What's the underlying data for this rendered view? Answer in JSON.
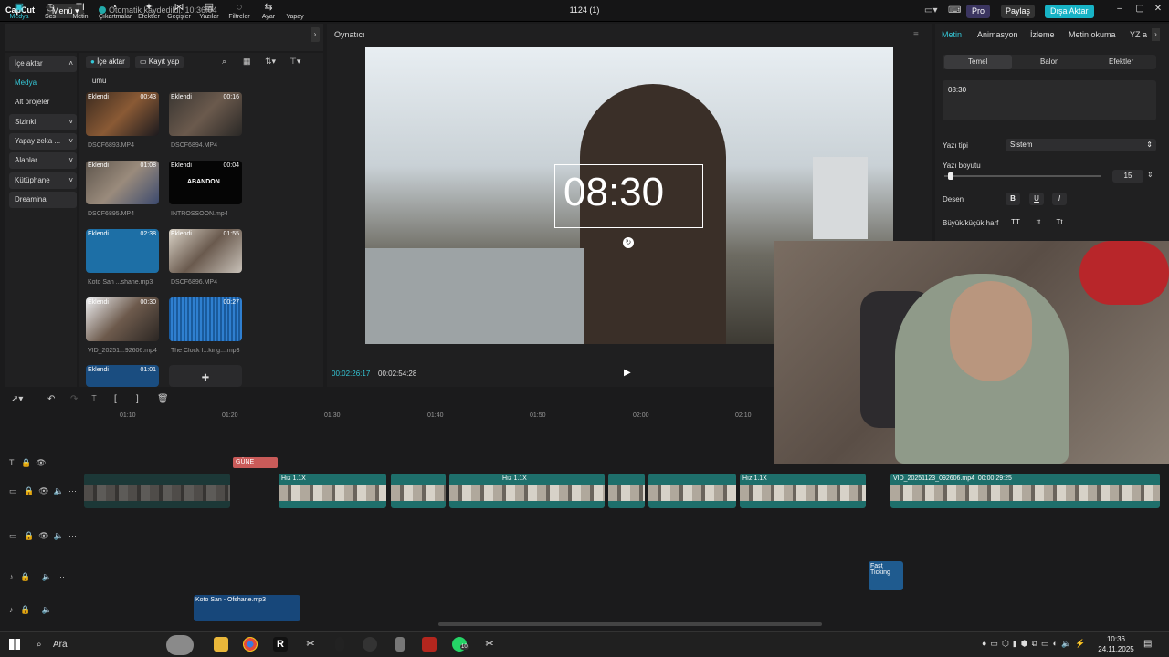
{
  "titlebar": {
    "logo": "CapCut",
    "menu": "Menü",
    "autosave": "Otomatik kaydedildi: 10:36:04",
    "project_title": "1124 (1)",
    "pro": "Pro",
    "share": "Paylaş",
    "export": "Dışa Aktar"
  },
  "left_tabs": [
    "Medya",
    "Ses",
    "Metin",
    "Çıkartmalar",
    "Efektler",
    "Geçişler",
    "Yazılar",
    "Filtreler",
    "Ayar",
    "Yapay"
  ],
  "side_nav": [
    "İçe aktar",
    "Medya",
    "Alt projeler",
    "Sizinki",
    "Yapay zeka ...",
    "Alanlar",
    "Kütüphane",
    "Dreamina"
  ],
  "media": {
    "import": "İçe aktar",
    "record": "Kayıt yap",
    "all": "Tümü",
    "items": [
      {
        "tag": "Eklendi",
        "dur": "00:43",
        "name": "DSCF6893.MP4"
      },
      {
        "tag": "Eklendi",
        "dur": "00:16",
        "name": "DSCF6894.MP4"
      },
      {
        "tag": "Eklendi",
        "dur": "01:08",
        "name": "DSCF6895.MP4"
      },
      {
        "tag": "Eklendi",
        "dur": "00:04",
        "name": "INTROSSOON.mp4"
      },
      {
        "tag": "Eklendi",
        "dur": "02:38",
        "name": "Koto San ...shane.mp3"
      },
      {
        "tag": "Eklendi",
        "dur": "01:55",
        "name": "DSCF6896.MP4"
      },
      {
        "tag": "Eklendi",
        "dur": "00:30",
        "name": "VID_20251...92606.mp4"
      },
      {
        "tag": "",
        "dur": "00:27",
        "name": "The Clock I...king....mp3"
      },
      {
        "tag": "Eklendi",
        "dur": "01:01",
        "name": ""
      }
    ],
    "abandon_label": "ABANDON"
  },
  "player": {
    "title": "Oynatıcı",
    "overlay_text": "08:30",
    "current_time": "00:02:26:17",
    "total_time": "00:02:54:28"
  },
  "right_panel": {
    "tabs": [
      "Metin",
      "Animasyon",
      "İzleme",
      "Metin okuma",
      "YZ a"
    ],
    "subtabs": [
      "Temel",
      "Balon",
      "Efektler"
    ],
    "text_value": "08:30",
    "font_label": "Yazı tipi",
    "font_value": "Sistem",
    "size_label": "Yazı boyutu",
    "size_value": "15",
    "size_fraction": 0.04,
    "pattern_label": "Desen",
    "case_label": "Büyük/küçük harf",
    "format_buttons": [
      "B",
      "U",
      "I"
    ],
    "case_buttons": [
      "TT",
      "tt",
      "Tt"
    ]
  },
  "timeline": {
    "ruler": [
      "01:10",
      "01:20",
      "01:30",
      "01:40",
      "01:50",
      "02:00",
      "02:10"
    ],
    "text_clip": "GÜNE FARKIND",
    "speed_label": "Hız 1.1X",
    "video_clip_label": "VID_20251123_092606.mp4",
    "video_clip_dur": "00:00:29:25",
    "fast_clip": "Fast Ticking",
    "audio_clip": "Koto San - Ofshane.mp3"
  },
  "taskbar": {
    "search": "Ara",
    "time": "10:36",
    "date": "24.11.2025",
    "whatsapp_badge": "10"
  }
}
